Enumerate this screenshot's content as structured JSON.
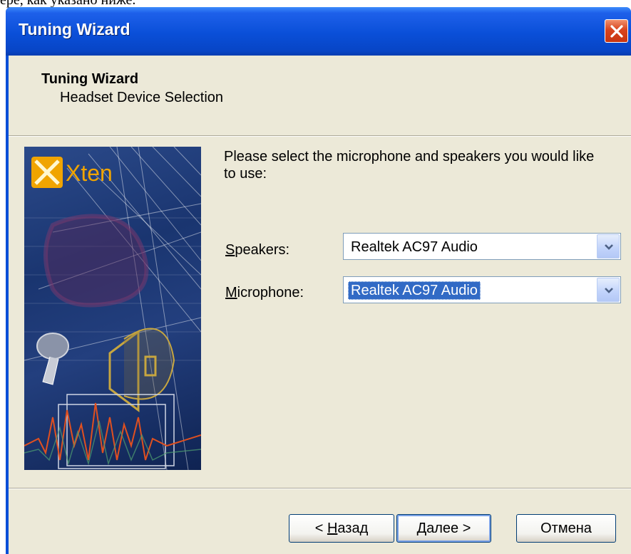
{
  "document": {
    "text": "ере, как указано ниже."
  },
  "window": {
    "title": "Tuning Wizard",
    "close_icon": "close-icon"
  },
  "header": {
    "title": "Tuning Wizard",
    "subtitle": "Headset Device Selection"
  },
  "banner": {
    "brand": "Xten"
  },
  "content": {
    "prompt": "Please select the microphone and speakers you would like to use:",
    "speakers": {
      "label_mnemonic": "S",
      "label_rest": "peakers:",
      "value": "Realtek AC97 Audio"
    },
    "microphone": {
      "label_mnemonic": "M",
      "label_rest": "icrophone:",
      "value": "Realtek AC97 Audio"
    }
  },
  "buttons": {
    "back": {
      "prefix": "< ",
      "mnemonic": "Н",
      "rest": "азад"
    },
    "next": {
      "mnemonic": "Д",
      "rest": "алее >"
    },
    "cancel": {
      "label": "Отмена"
    }
  },
  "colors": {
    "titlebar": "#0a4fd8",
    "face": "#ece9d8",
    "selection": "#316ac5",
    "close": "#d8441e"
  }
}
